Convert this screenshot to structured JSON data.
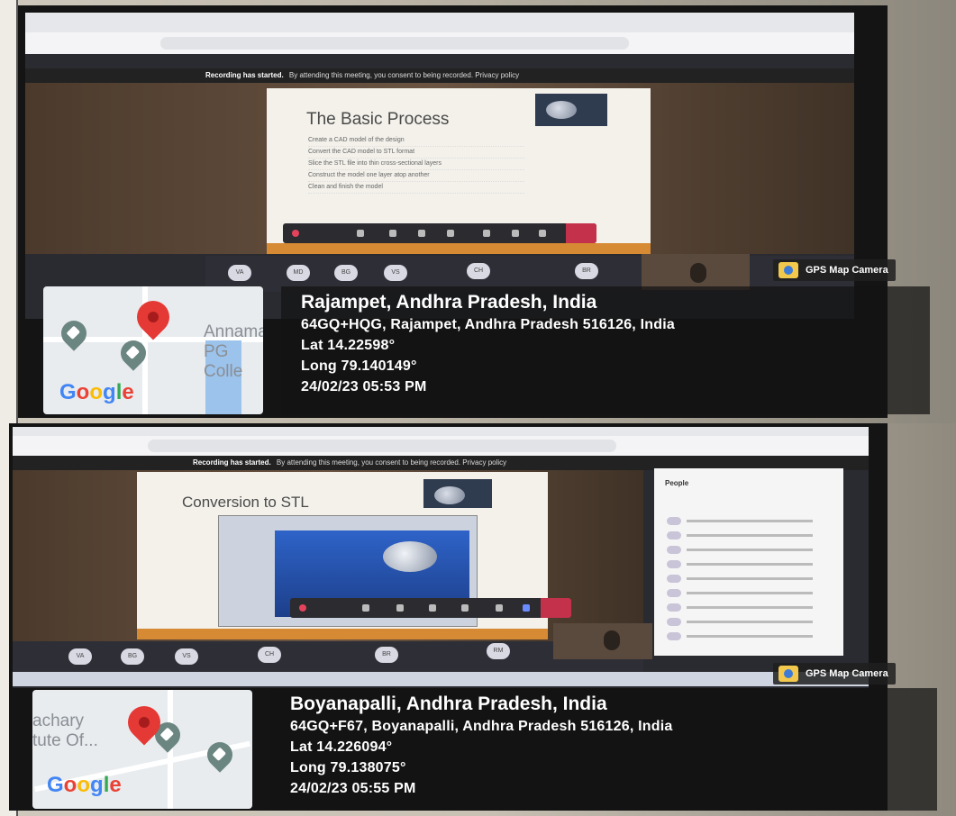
{
  "photo1": {
    "banner": {
      "bold": "Recording has started.",
      "rest": "By attending this meeting, you consent to being recorded. Privacy policy"
    },
    "slide": {
      "title": "The Basic Process",
      "bullets": [
        "Create a CAD model of the design",
        "Convert the CAD model to STL format",
        "Slice the STL file into thin cross-sectional layers",
        "Construct the model one layer atop another",
        "Clean and finish the model"
      ]
    },
    "avatars": [
      "VA",
      "MD",
      "BG",
      "VS",
      "CH",
      "BR"
    ],
    "map": {
      "label1": "Annama",
      "label2": "PG Colle",
      "google": [
        "G",
        "o",
        "o",
        "g",
        "l",
        "e"
      ]
    },
    "gps": {
      "label": "GPS Map Camera"
    },
    "info": {
      "location": "Rajampet, Andhra Pradesh, India",
      "address": "64GQ+HQG, Rajampet, Andhra Pradesh 516126, India",
      "lat": "Lat 14.22598°",
      "long": "Long 79.140149°",
      "datetime": "24/02/23 05:53 PM"
    }
  },
  "photo2": {
    "banner": {
      "bold": "Recording has started.",
      "rest": "By attending this meeting, you consent to being recorded. Privacy policy"
    },
    "slide": {
      "title": "Conversion to STL"
    },
    "people_title": "People",
    "avatars": [
      "VA",
      "BG",
      "VS",
      "CH",
      "BR",
      "RM"
    ],
    "map": {
      "label1": "achary",
      "label2": "tute Of...",
      "google": [
        "G",
        "o",
        "o",
        "g",
        "l",
        "e"
      ]
    },
    "gps": {
      "label": "GPS Map Camera"
    },
    "info": {
      "location": "Boyanapalli, Andhra Pradesh, India",
      "address": "64GQ+F67, Boyanapalli, Andhra Pradesh 516126, India",
      "lat": "Lat 14.226094°",
      "long": "Long 79.138075°",
      "datetime": "24/02/23 05:55 PM"
    }
  }
}
